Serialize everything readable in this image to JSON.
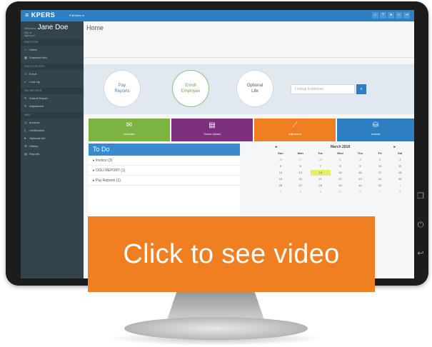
{
  "app": {
    "logo": "KPERS",
    "menu_label": "Full Menu ▾",
    "top_icons": [
      "home-icon",
      "help-icon",
      "user-icon",
      "search-icon",
      "logout-icon"
    ]
  },
  "user": {
    "prefix": "Welcome",
    "name": "Jane Doe",
    "line1": "City of",
    "line2": "Agency X"
  },
  "sidebar": {
    "sections": [
      {
        "heading": "EMPLOYER",
        "items": [
          {
            "label": "Home",
            "icon": "home-icon"
          },
          {
            "label": "Employer Info",
            "icon": "building-icon"
          }
        ]
      },
      {
        "heading": "EMPLOYEE INFO",
        "items": [
          {
            "label": "Enroll",
            "icon": "user-plus-icon"
          },
          {
            "label": "Look Up",
            "icon": "search-icon"
          }
        ]
      },
      {
        "heading": "PAY REPORTS",
        "items": [
          {
            "label": "Submit Report",
            "icon": "pencil-icon"
          },
          {
            "label": "Adjustment",
            "icon": "pencil-icon"
          }
        ]
      },
      {
        "heading": "MISC",
        "items": [
          {
            "label": "Invoices",
            "icon": "clock-icon"
          },
          {
            "label": "Certification",
            "icon": "file-icon"
          },
          {
            "label": "Optional Life",
            "icon": "heart-icon"
          },
          {
            "label": "History",
            "icon": "list-icon"
          },
          {
            "label": "Reports",
            "icon": "chart-icon"
          }
        ]
      }
    ]
  },
  "main": {
    "page_title": "Home",
    "quick": {
      "pay_reports": "Pay\nReports",
      "enroll": "Enroll\nEmployee",
      "optional_life": "Optional\nLife"
    },
    "lookup_placeholder": "Lookup Employee",
    "tiles": [
      {
        "label": "Messages",
        "color": "#7cb342",
        "icon": "envelope-icon"
      },
      {
        "label": "Secure Upload",
        "color": "#7b2f7e",
        "icon": "upload-icon"
      },
      {
        "label": "Adjustment",
        "color": "#ef7f21",
        "icon": "chart-icon"
      },
      {
        "label": "Invoices",
        "color": "#2d7fc1",
        "icon": "money-icon"
      }
    ],
    "todo": {
      "title": "To Do",
      "items": [
        "Invoice (3)",
        "OGLI REPORT (1)",
        "Pay Reports (1)"
      ]
    },
    "calendar": {
      "month": "March 2018",
      "days": [
        "Sun",
        "Mon",
        "Tue",
        "Wed",
        "Thu",
        "Fri",
        "Sat"
      ],
      "weeks": [
        [
          "26",
          "27",
          "28",
          "1",
          "2",
          "3",
          "4"
        ],
        [
          "5",
          "6",
          "7",
          "8",
          "9",
          "10",
          "11"
        ],
        [
          "12",
          "13",
          "14",
          "15",
          "16",
          "17",
          "18"
        ],
        [
          "19",
          "20",
          "21",
          "22",
          "23",
          "24",
          "25"
        ],
        [
          "26",
          "27",
          "28",
          "29",
          "30",
          "31",
          "1"
        ],
        [
          "2",
          "3",
          "4",
          "5",
          "6",
          "7",
          "8"
        ]
      ],
      "today": "14"
    }
  },
  "overlay": {
    "label": "Click to see video",
    "color": "#ef7f21"
  }
}
